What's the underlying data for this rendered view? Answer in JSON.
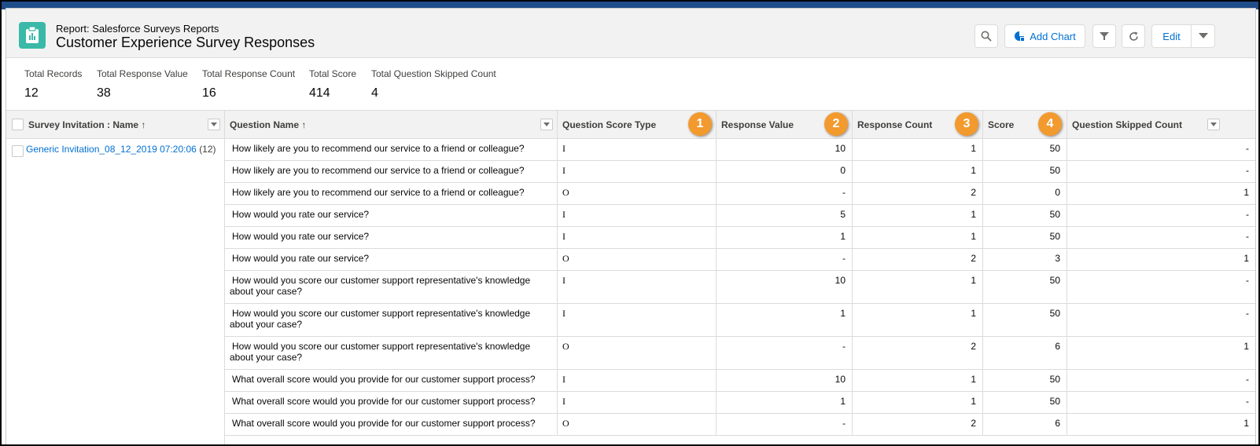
{
  "header": {
    "subtitle": "Report: Salesforce Surveys Reports",
    "title": "Customer Experience Survey Responses",
    "add_chart_label": "Add Chart",
    "edit_label": "Edit"
  },
  "summary": [
    {
      "label": "Total Records",
      "value": "12"
    },
    {
      "label": "Total Response Value",
      "value": "38"
    },
    {
      "label": "Total Response Count",
      "value": "16"
    },
    {
      "label": "Total Score",
      "value": "414"
    },
    {
      "label": "Total Question Skipped Count",
      "value": "4"
    }
  ],
  "columns": {
    "invitation": "Survey Invitation : Name ↑",
    "question": "Question Name ↑",
    "score_type": "Question Score Type",
    "response_value": "Response Value",
    "response_count": "Response Count",
    "score": "Score",
    "skipped": "Question Skipped Count"
  },
  "badges": [
    "1",
    "2",
    "3",
    "4"
  ],
  "group": {
    "name": "Generic Invitation_08_12_2019 07:20:06",
    "count": "(12)"
  },
  "rows": [
    {
      "q": "How likely are you to recommend our service to a friend or colleague?",
      "type": "I",
      "rv": "10",
      "rc": "1",
      "score": "50",
      "skip": "-"
    },
    {
      "q": "How likely are you to recommend our service to a friend or colleague?",
      "type": "I",
      "rv": "0",
      "rc": "1",
      "score": "50",
      "skip": "-"
    },
    {
      "q": "How likely are you to recommend our service to a friend or colleague?",
      "type": "O",
      "rv": "-",
      "rc": "2",
      "score": "0",
      "skip": "1"
    },
    {
      "q": "How would you rate our service?",
      "type": "I",
      "rv": "5",
      "rc": "1",
      "score": "50",
      "skip": "-"
    },
    {
      "q": "How would you rate our service?",
      "type": "I",
      "rv": "1",
      "rc": "1",
      "score": "50",
      "skip": "-"
    },
    {
      "q": "How would you rate our service?",
      "type": "O",
      "rv": "-",
      "rc": "2",
      "score": "3",
      "skip": "1"
    },
    {
      "q": "How would you score our customer support representative's knowledge about your case?",
      "type": "I",
      "rv": "10",
      "rc": "1",
      "score": "50",
      "skip": "-"
    },
    {
      "q": "How would you score our customer support representative's knowledge about your case?",
      "type": "I",
      "rv": "1",
      "rc": "1",
      "score": "50",
      "skip": "-"
    },
    {
      "q": "How would you score our customer support representative's knowledge about your case?",
      "type": "O",
      "rv": "-",
      "rc": "2",
      "score": "6",
      "skip": "1"
    },
    {
      "q": "What overall score would you provide for our customer support process?",
      "type": "I",
      "rv": "10",
      "rc": "1",
      "score": "50",
      "skip": "-"
    },
    {
      "q": "What overall score would you provide for our customer support process?",
      "type": "I",
      "rv": "1",
      "rc": "1",
      "score": "50",
      "skip": "-"
    },
    {
      "q": "What overall score would you provide for our customer support process?",
      "type": "O",
      "rv": "-",
      "rc": "2",
      "score": "6",
      "skip": "1"
    }
  ],
  "colors": {
    "accent": "#0070d2",
    "icon_bg": "#3bb9a8",
    "badge": "#f29a2e",
    "border": "#dddbda"
  }
}
